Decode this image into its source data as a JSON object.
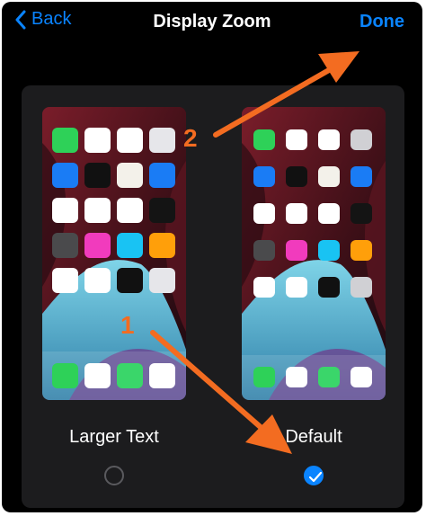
{
  "nav": {
    "back_label": "Back",
    "title": "Display Zoom",
    "done_label": "Done"
  },
  "options": [
    {
      "label": "Larger Text",
      "selected": false
    },
    {
      "label": "Default",
      "selected": true
    }
  ],
  "annotations": {
    "step1": "1",
    "step2": "2",
    "arrow_color": "#f36c21"
  },
  "colors": {
    "accent": "#0a84ff",
    "background": "#000000",
    "card": "#1c1c1e"
  }
}
